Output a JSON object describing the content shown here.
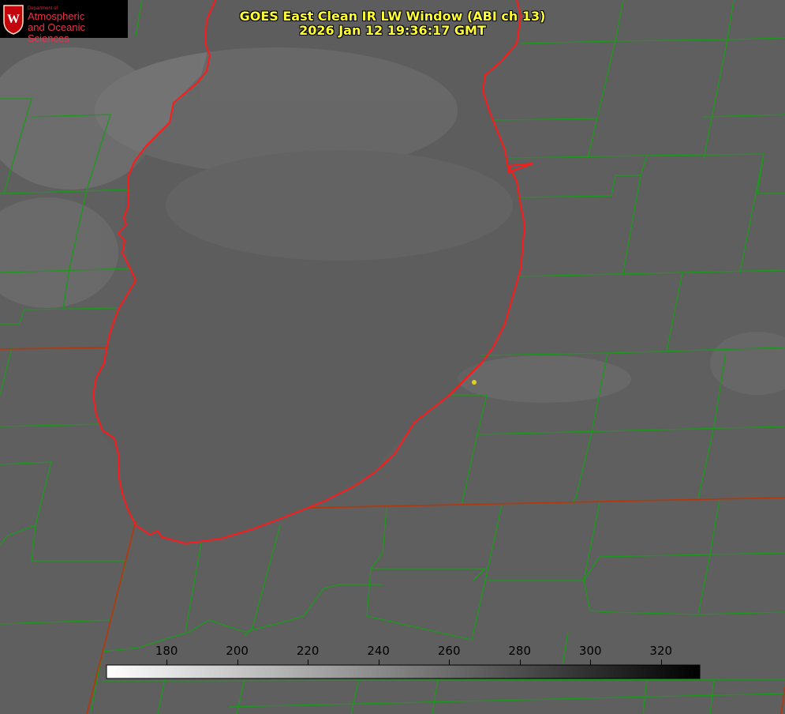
{
  "title": {
    "line1": "GOES East Clean IR LW Window (ABI ch 13)",
    "line2": "2026 Jan 12 19:36:17 GMT"
  },
  "logo": {
    "dept": "Department of",
    "line1": "Atmospheric",
    "line2": "and Oceanic Sciences",
    "seal_letter": "W"
  },
  "colorbar": {
    "vmin": 163,
    "vmax": 331,
    "colormap": "grayscale, white at minimum to black at maximum",
    "ticks": [
      180,
      200,
      220,
      240,
      260,
      280,
      300,
      320
    ]
  },
  "colors": {
    "background": "#5e5e5e",
    "lake": "#5b5b5b",
    "county_lines": "#1a9a1a",
    "shoreline": "#ff1a1a",
    "title": "#ffff33",
    "marker": "#e0d020"
  }
}
